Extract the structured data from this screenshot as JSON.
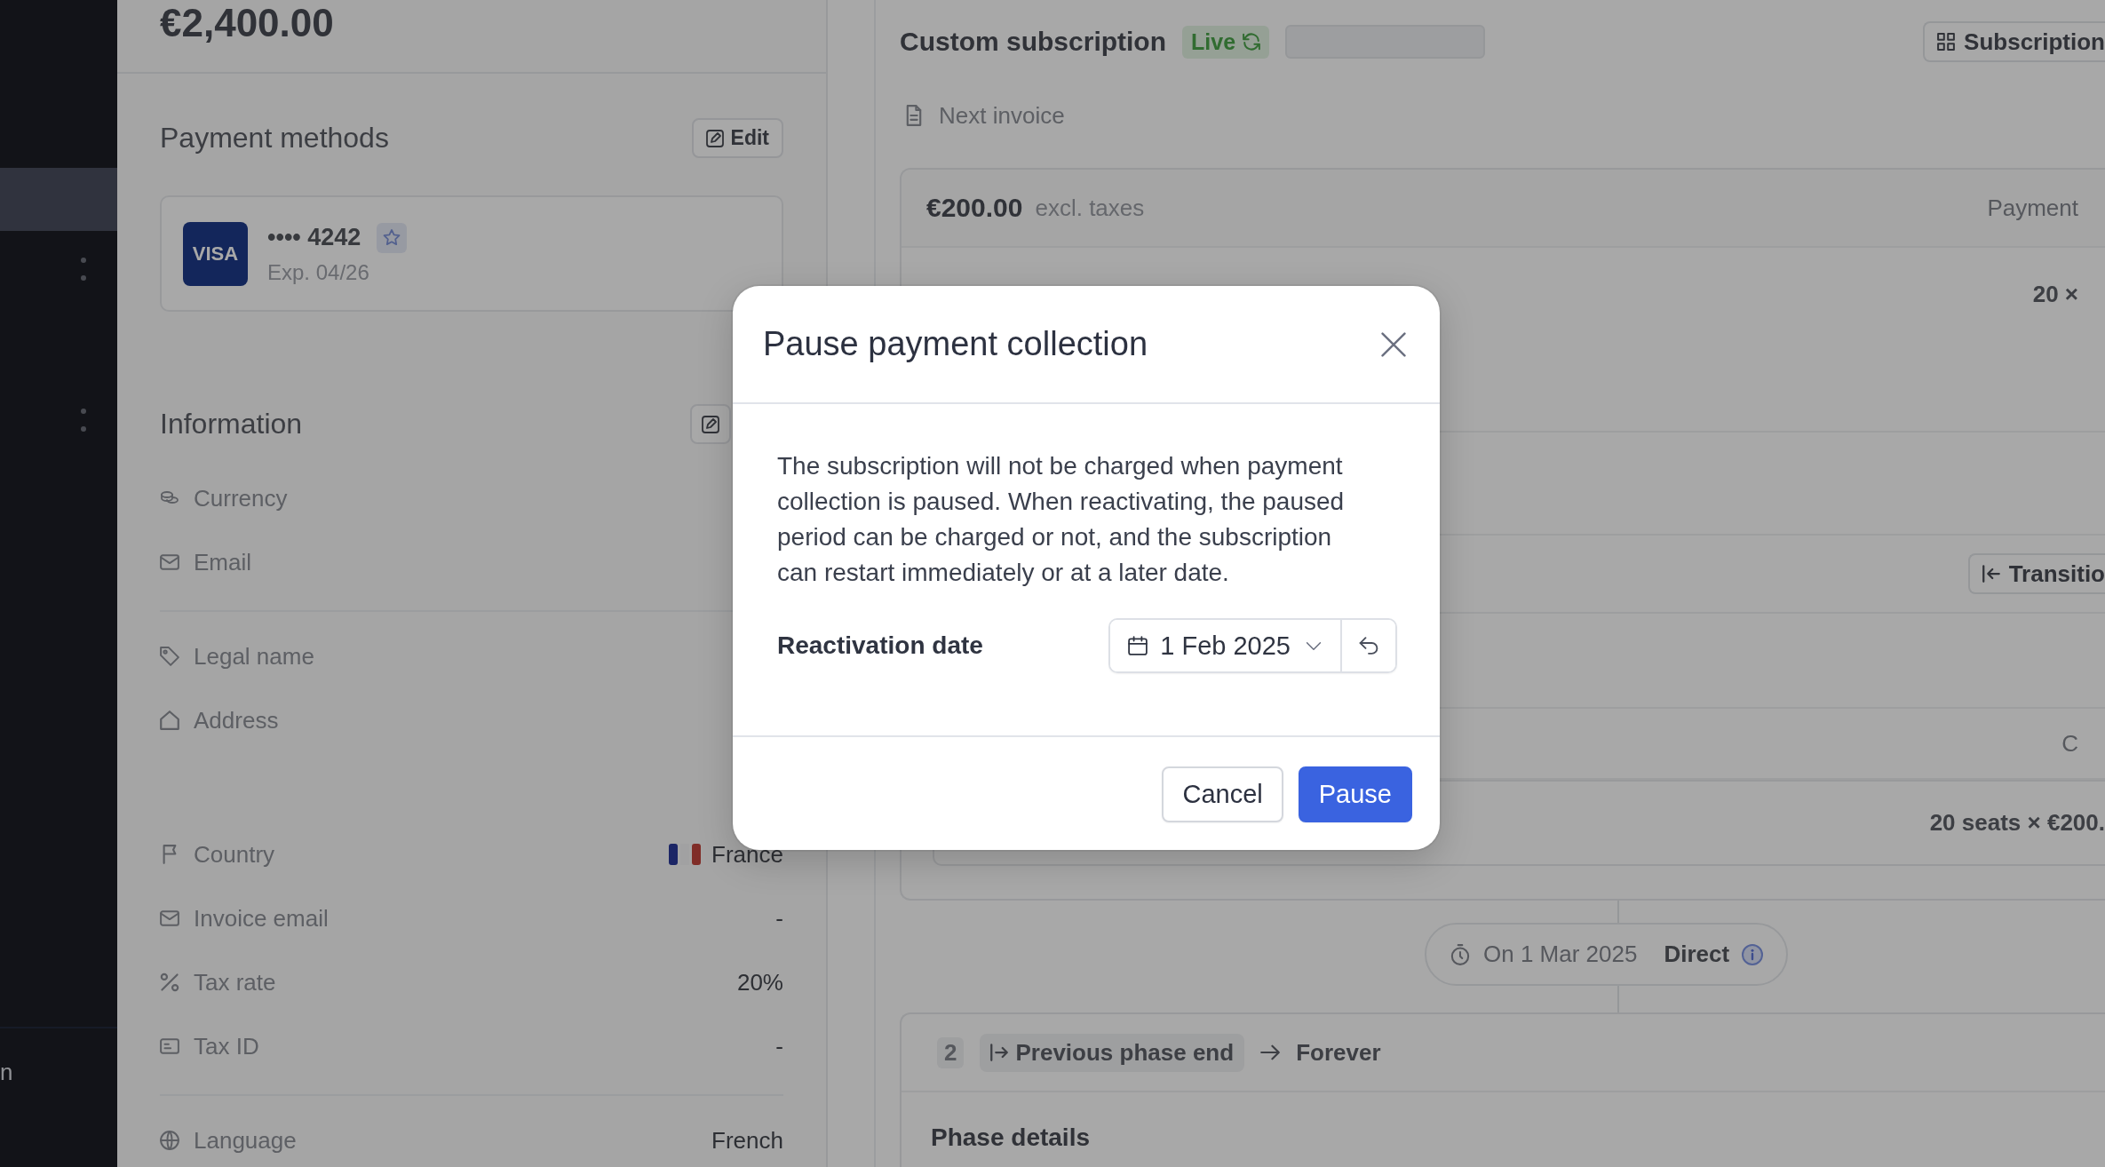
{
  "sidebar": {
    "items": [
      {
        "selected": true,
        "menu": false
      },
      {
        "selected": false,
        "menu": true
      },
      {
        "selected": false,
        "menu": true
      }
    ],
    "footer_label": "n"
  },
  "customer": {
    "total": "€2,400.00",
    "payment_methods": {
      "title": "Payment methods",
      "edit_button": "Edit",
      "cards": [
        {
          "brand": "VISA",
          "number": "•••• 4242",
          "expiry": "Exp. 04/26",
          "default": true
        }
      ]
    },
    "information": {
      "title": "Information",
      "groups": [
        {
          "rows": [
            {
              "label": "Currency"
            },
            {
              "label": "Email"
            }
          ]
        },
        {
          "rows": [
            {
              "label": "Legal name"
            },
            {
              "label": "Address"
            },
            {
              "label": "Country",
              "value": "France",
              "flag": true
            },
            {
              "label": "Invoice email",
              "value": "-"
            },
            {
              "label": "Tax rate",
              "value": "20%"
            },
            {
              "label": "Tax ID",
              "value": "-"
            }
          ]
        },
        {
          "rows": [
            {
              "label": "Language",
              "value": "French"
            }
          ]
        }
      ]
    }
  },
  "subscription": {
    "title": "Custom subscription",
    "status": "Live",
    "action_button": "Subscription",
    "next_invoice_label": "Next invoice",
    "phase_1": {
      "amount": "€200.00",
      "amount_note": "excl. taxes",
      "column_2": "Payment",
      "quantity": "20 ×",
      "transition_button": "Transitio",
      "column_3": "C",
      "line_total": "20 seats × €200."
    },
    "transition": {
      "date": "On 1 Mar 2025",
      "mode": "Direct"
    },
    "phase_2": {
      "number": "2",
      "start": "Previous phase end",
      "end": "Forever",
      "section_title": "Phase details"
    }
  },
  "dialog": {
    "title": "Pause payment collection",
    "description": "The subscription will not be charged when payment collection is paused. When reactivating, the paused period can be charged or not, and the subscription can restart immediately or at a later date.",
    "reactivation_date": {
      "label": "Reactivation date",
      "value": "1 Feb 2025"
    },
    "buttons": [
      {
        "label": "Cancel",
        "kind": "secondary"
      },
      {
        "label": "Pause",
        "kind": "primary"
      }
    ]
  }
}
